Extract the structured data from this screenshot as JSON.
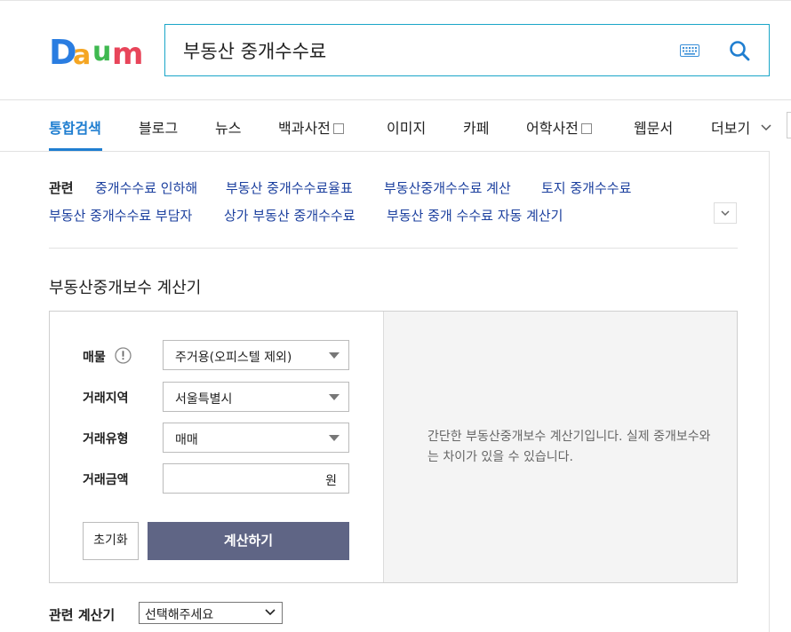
{
  "search": {
    "query": "부동산 중개수수료"
  },
  "tabs": [
    {
      "label": "통합검색",
      "active": true
    },
    {
      "label": "블로그"
    },
    {
      "label": "뉴스"
    },
    {
      "label": "백과사전"
    },
    {
      "label": "이미지"
    },
    {
      "label": "카페"
    },
    {
      "label": "어학사전"
    },
    {
      "label": "웹문서"
    },
    {
      "label": "더보기"
    }
  ],
  "related": {
    "label": "관련",
    "links": [
      "중개수수료 인하해",
      "부동산 중개수수료율표",
      "부동산중개수수료 계산",
      "토지 중개수수료",
      "부동산 중개수수료 부담자",
      "상가 부동산 중개수수료",
      "부동산 중개 수수료 자동 계산기"
    ]
  },
  "calculator": {
    "title": "부동산중개보수 계산기",
    "fields": {
      "property_label": "매물",
      "property_value": "주거용(오피스텔 제외)",
      "region_label": "거래지역",
      "region_value": "서울특별시",
      "type_label": "거래유형",
      "type_value": "매매",
      "amount_label": "거래금액",
      "amount_value": "",
      "amount_unit": "원"
    },
    "reset_label": "초기화",
    "submit_label": "계산하기",
    "description": "간단한 부동산중개보수 계산기입니다. 실제 중개보수와는 차이가 있을 수 있습니다."
  },
  "related_calculator": {
    "label": "관련 계산기",
    "selected": "선택해주세요"
  },
  "colors": {
    "accent": "#1f7ed0",
    "search_border": "#1aa6c8",
    "link": "#1b3f9e",
    "button": "#5f6585"
  },
  "icons": {
    "keyboard": "keyboard-icon",
    "search": "search-icon",
    "info": "info-icon",
    "more": "chevron-down-icon"
  }
}
